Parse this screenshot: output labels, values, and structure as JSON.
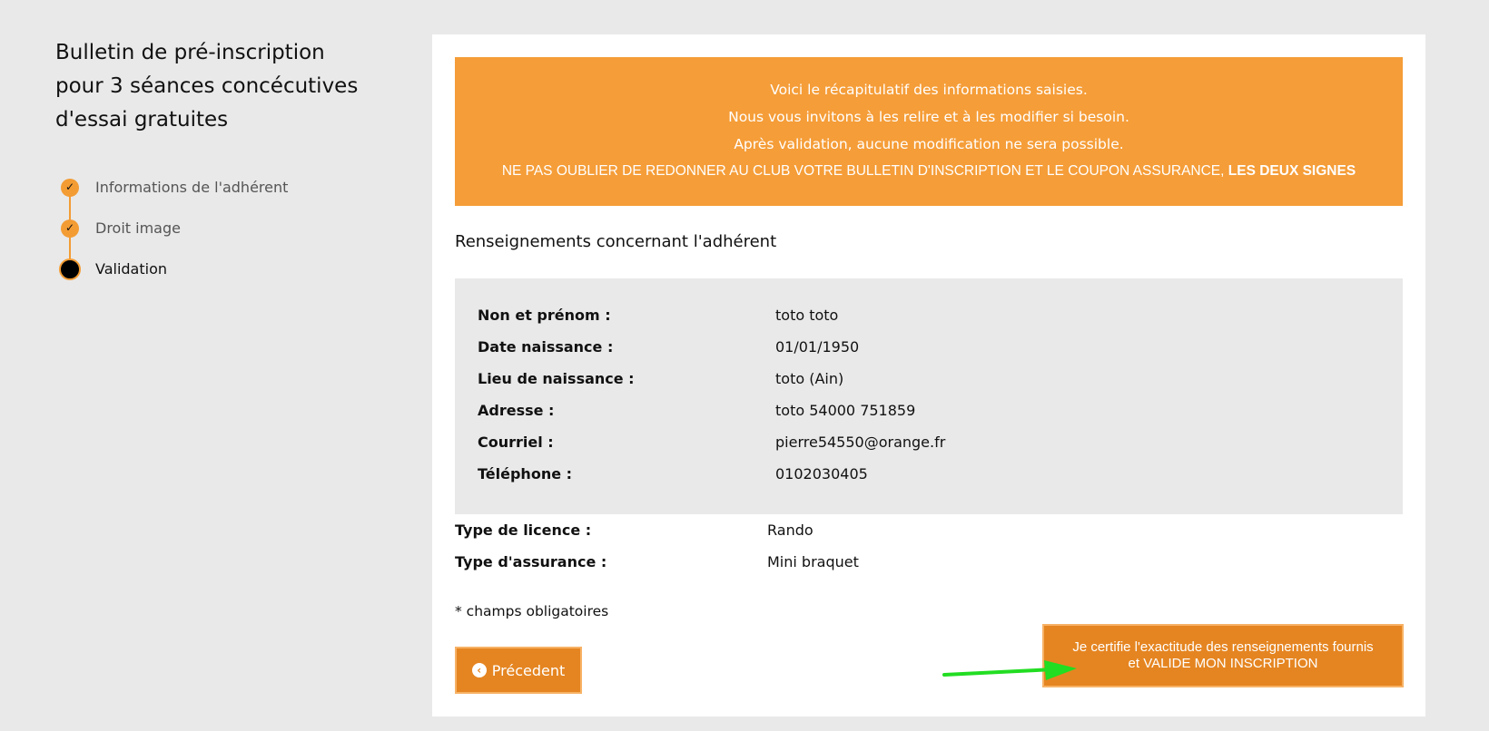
{
  "sidebar": {
    "title_lines": [
      "Bulletin de pré-inscription",
      "pour 3 séances concécutives",
      "d'essai gratuites"
    ],
    "steps": [
      {
        "label": "Informations de l'adhérent",
        "state": "done"
      },
      {
        "label": "Droit image",
        "state": "done"
      },
      {
        "label": "Validation",
        "state": "active"
      }
    ]
  },
  "notice": {
    "line1": "Voici le récapitulatif des informations saisies.",
    "line2": "Nous vous invitons à les relire et à les modifier si besoin.",
    "line3": "Après validation, aucune modification ne sera possible.",
    "line4": "NE PAS OUBLIER DE REDONNER AU CLUB VOTRE BULLETIN D'INSCRIPTION ET LE COUPON ASSURANCE,",
    "line4_bold": "LES DEUX SIGNES",
    "color": "#f59d38"
  },
  "section": {
    "title": "Renseignements concernant l'adhérent"
  },
  "member": {
    "name_label": "Non et prénom :",
    "name_value": "toto toto",
    "birthdate_label": "Date naissance :",
    "birthdate_value": "01/01/1950",
    "birthplace_label": "Lieu de naissance :",
    "birthplace_value": "toto (Ain)",
    "address_label": "Adresse :",
    "address_value": "toto 54000 751859",
    "email_label": "Courriel :",
    "email_value": "pierre54550@orange.fr",
    "phone_label": "Téléphone :",
    "phone_value": "0102030405"
  },
  "license": {
    "type_label": "Type de licence :",
    "type_value": "Rando",
    "insurance_label": "Type d'assurance :",
    "insurance_value": "Mini braquet"
  },
  "required_note": "* champs obligatoires",
  "buttons": {
    "prev_label": "Précedent",
    "prev_icon": "chevron-left-circle-icon",
    "validate_line1": "Je certifie l'exactitude des renseignements fournis",
    "validate_line2": "et VALIDE MON INSCRIPTION",
    "accent_color": "#e58521"
  },
  "annotation": {
    "arrow_icon": "green-arrow-icon",
    "arrow_color": "#22dd22"
  }
}
